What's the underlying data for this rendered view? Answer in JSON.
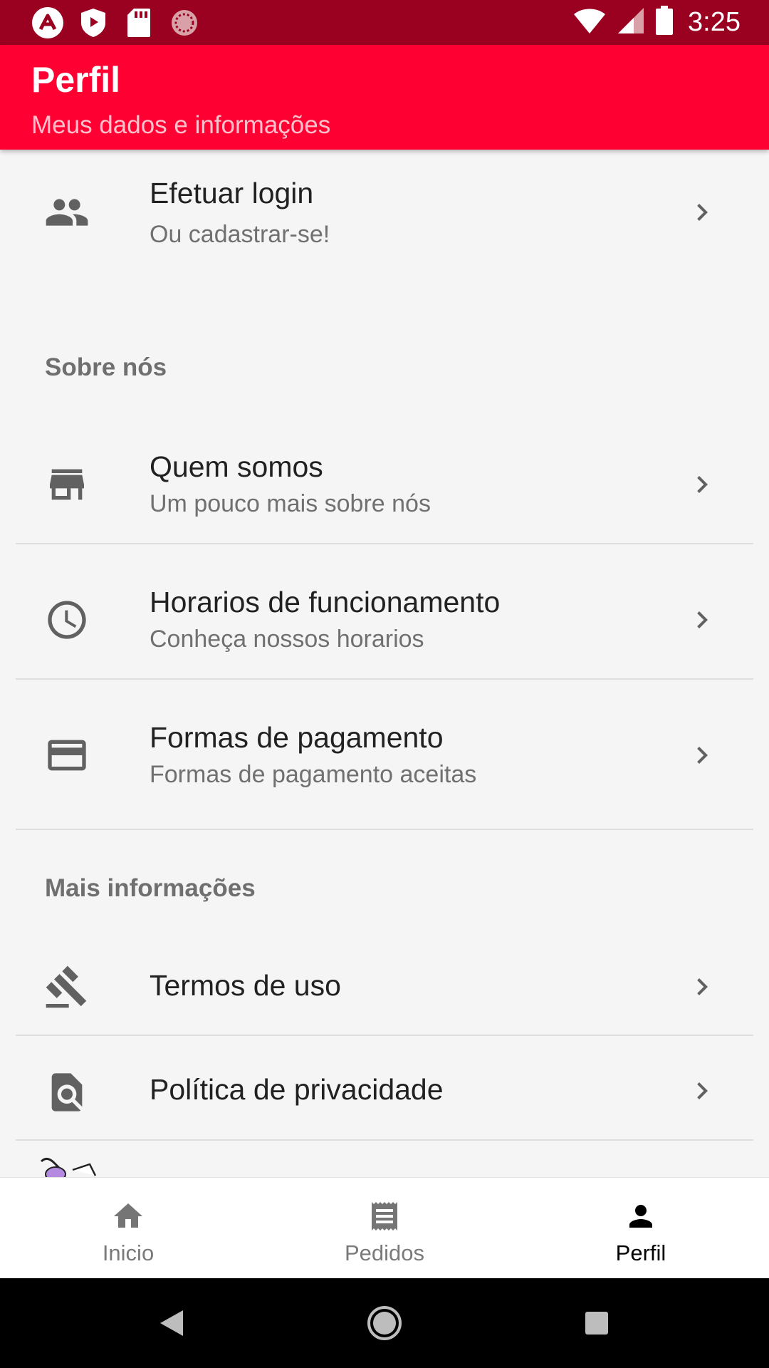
{
  "status_bar": {
    "time": "3:25",
    "left_icons": [
      "app-a-icon",
      "shield-play-icon",
      "sd-card-icon",
      "loading-circle-icon"
    ],
    "right_icons": [
      "wifi-icon",
      "signal-icon",
      "battery-icon"
    ]
  },
  "app_bar": {
    "title": "Perfil",
    "subtitle": "Meus dados e informações",
    "color": "#ff0033"
  },
  "login": {
    "title": "Efetuar login",
    "subtitle": "Ou cadastrar-se!",
    "icon": "people-icon"
  },
  "sections": {
    "about": {
      "header": "Sobre nós",
      "items": [
        {
          "title": "Quem somos",
          "subtitle": "Um pouco mais sobre nós",
          "icon": "store-icon"
        },
        {
          "title": "Horarios de funcionamento",
          "subtitle": "Conheça nossos horarios",
          "icon": "clock-icon"
        },
        {
          "title": "Formas de pagamento",
          "subtitle": "Formas de pagamento aceitas",
          "icon": "credit-card-icon"
        }
      ]
    },
    "more": {
      "header": "Mais informações",
      "items": [
        {
          "title": "Termos de uso",
          "icon": "gavel-icon"
        },
        {
          "title": "Política de privacidade",
          "icon": "find-in-page-icon"
        }
      ]
    }
  },
  "bottom_nav": {
    "items": [
      {
        "label": "Inicio",
        "icon": "home-icon",
        "active": false
      },
      {
        "label": "Pedidos",
        "icon": "receipt-icon",
        "active": false
      },
      {
        "label": "Perfil",
        "icon": "person-icon",
        "active": true
      }
    ]
  },
  "system_nav": [
    "back-icon",
    "home-circle-icon",
    "recents-icon"
  ]
}
